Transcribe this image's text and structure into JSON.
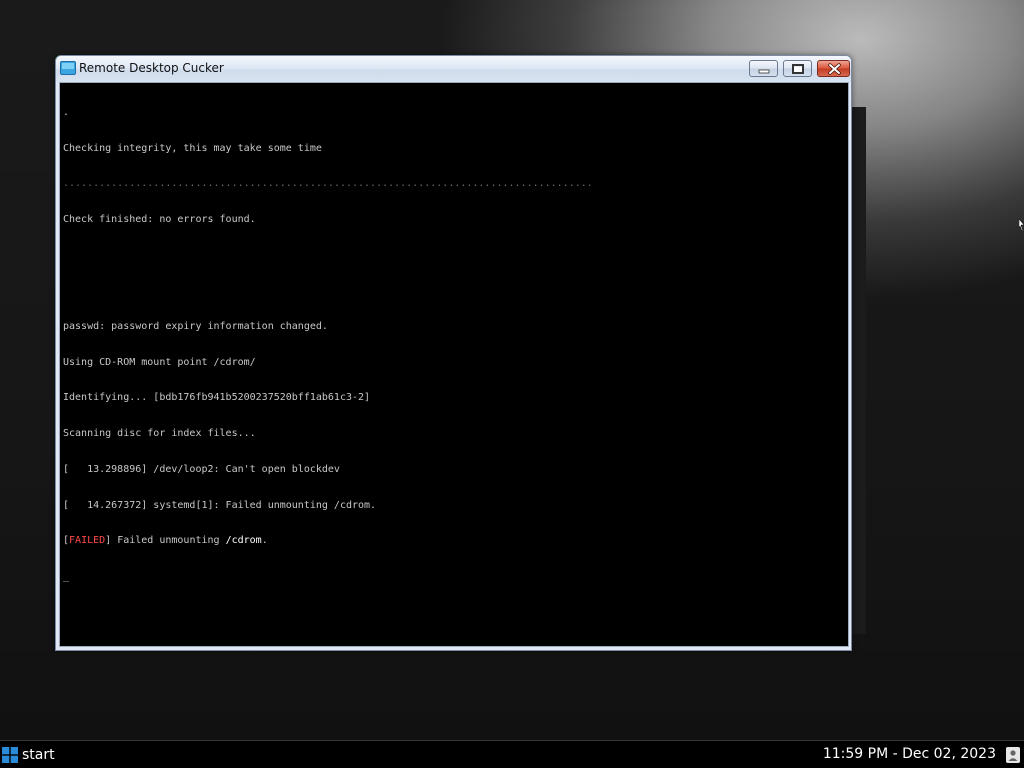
{
  "window": {
    "title": "Remote Desktop Cucker",
    "icon": "remote-desktop-icon",
    "controls": [
      "minimize-icon",
      "maximize-icon",
      "close-icon"
    ]
  },
  "console": {
    "lines": [
      ".",
      "Checking integrity, this may take some time",
      "........................................................................................",
      "Check finished: no errors found.",
      "",
      "",
      "passwd: password expiry information changed.",
      "Using CD-ROM mount point /cdrom/",
      "Identifying... [bdb176fb941b5200237520bff1ab61c3-2]",
      "Scanning disc for index files...",
      "[   13.298896] /dev/loop2: Can't open blockdev",
      "[   14.267372] systemd[1]: Failed unmounting /cdrom."
    ],
    "failed_tag": "FAILED",
    "failed_open": "[",
    "failed_close": "]",
    "failed_message": " Failed unmounting ",
    "failed_path": "/cdrom",
    "failed_end": ".",
    "cursor": "_",
    "colors": {
      "background": "#000000",
      "text": "#c8c8c8",
      "failed": "#ff4a4a"
    }
  },
  "taskbar": {
    "start_label": "start",
    "start_icon": "windows-logo-icon",
    "clock": "11:59 PM - Dec 02, 2023",
    "tray_icon": "user-icon"
  }
}
